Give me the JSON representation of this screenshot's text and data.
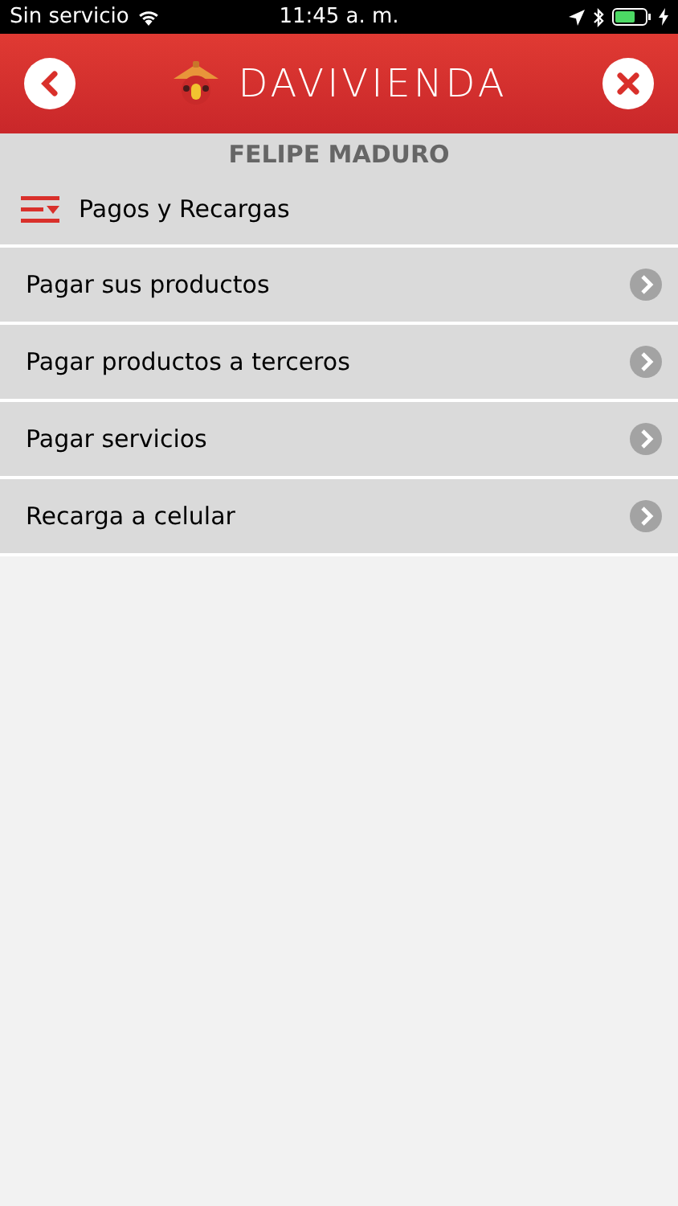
{
  "status_bar": {
    "carrier": "Sin servicio",
    "time": "11:45 a. m."
  },
  "header": {
    "brand": "DAVIVIENDA"
  },
  "user_name": "FELIPE MADURO",
  "section": {
    "title": "Pagos y Recargas"
  },
  "menu_items": [
    {
      "label": "Pagar sus productos"
    },
    {
      "label": "Pagar productos a terceros"
    },
    {
      "label": "Pagar servicios"
    },
    {
      "label": "Recarga a celular"
    }
  ]
}
